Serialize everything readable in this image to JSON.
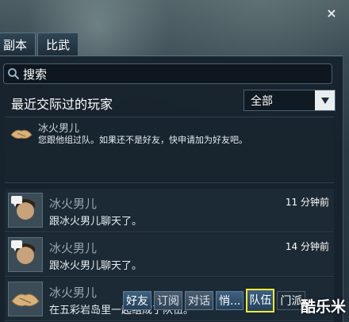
{
  "window": {
    "close_label": "×"
  },
  "tabs": [
    {
      "label": "副本"
    },
    {
      "label": "比武"
    }
  ],
  "search": {
    "value": "搜索"
  },
  "section": {
    "title": "最近交际过的玩家"
  },
  "filter": {
    "selected": "全部"
  },
  "notice": {
    "name": "冰火男儿",
    "message": "您跟他组过队。如果还不是好友，快申请加为好友吧。"
  },
  "conversations": [
    {
      "name": "冰火男儿",
      "message": "跟冰火男儿聊天了。",
      "time": "11 分钟前"
    },
    {
      "name": "冰火男儿",
      "message": "跟冰火男儿聊天了。",
      "time": "14 分钟前"
    },
    {
      "name": "冰火男儿",
      "message": "在五彩岩岛里一起组成了队伍。",
      "time": ""
    }
  ],
  "actions": {
    "friend": "好友",
    "subscribe": "订阅",
    "chat": "对话",
    "whisper": "悄...",
    "team": "队伍",
    "faction": "门派"
  },
  "watermark": "酷乐米",
  "icons": {
    "close": "close-icon",
    "search": "search-icon",
    "dropdown": "chevron-down-icon"
  },
  "colors": {
    "highlight": "#f3e73a",
    "panel": "#16212b"
  }
}
